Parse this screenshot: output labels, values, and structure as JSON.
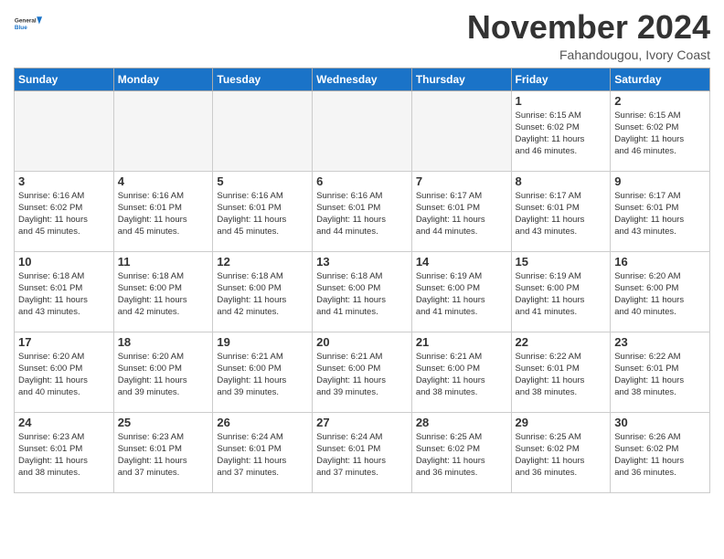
{
  "header": {
    "logo_line1": "General",
    "logo_line2": "Blue",
    "month_title": "November 2024",
    "location": "Fahandougou, Ivory Coast"
  },
  "weekdays": [
    "Sunday",
    "Monday",
    "Tuesday",
    "Wednesday",
    "Thursday",
    "Friday",
    "Saturday"
  ],
  "weeks": [
    [
      {
        "day": "",
        "info": ""
      },
      {
        "day": "",
        "info": ""
      },
      {
        "day": "",
        "info": ""
      },
      {
        "day": "",
        "info": ""
      },
      {
        "day": "",
        "info": ""
      },
      {
        "day": "1",
        "info": "Sunrise: 6:15 AM\nSunset: 6:02 PM\nDaylight: 11 hours\nand 46 minutes."
      },
      {
        "day": "2",
        "info": "Sunrise: 6:15 AM\nSunset: 6:02 PM\nDaylight: 11 hours\nand 46 minutes."
      }
    ],
    [
      {
        "day": "3",
        "info": "Sunrise: 6:16 AM\nSunset: 6:02 PM\nDaylight: 11 hours\nand 45 minutes."
      },
      {
        "day": "4",
        "info": "Sunrise: 6:16 AM\nSunset: 6:01 PM\nDaylight: 11 hours\nand 45 minutes."
      },
      {
        "day": "5",
        "info": "Sunrise: 6:16 AM\nSunset: 6:01 PM\nDaylight: 11 hours\nand 45 minutes."
      },
      {
        "day": "6",
        "info": "Sunrise: 6:16 AM\nSunset: 6:01 PM\nDaylight: 11 hours\nand 44 minutes."
      },
      {
        "day": "7",
        "info": "Sunrise: 6:17 AM\nSunset: 6:01 PM\nDaylight: 11 hours\nand 44 minutes."
      },
      {
        "day": "8",
        "info": "Sunrise: 6:17 AM\nSunset: 6:01 PM\nDaylight: 11 hours\nand 43 minutes."
      },
      {
        "day": "9",
        "info": "Sunrise: 6:17 AM\nSunset: 6:01 PM\nDaylight: 11 hours\nand 43 minutes."
      }
    ],
    [
      {
        "day": "10",
        "info": "Sunrise: 6:18 AM\nSunset: 6:01 PM\nDaylight: 11 hours\nand 43 minutes."
      },
      {
        "day": "11",
        "info": "Sunrise: 6:18 AM\nSunset: 6:00 PM\nDaylight: 11 hours\nand 42 minutes."
      },
      {
        "day": "12",
        "info": "Sunrise: 6:18 AM\nSunset: 6:00 PM\nDaylight: 11 hours\nand 42 minutes."
      },
      {
        "day": "13",
        "info": "Sunrise: 6:18 AM\nSunset: 6:00 PM\nDaylight: 11 hours\nand 41 minutes."
      },
      {
        "day": "14",
        "info": "Sunrise: 6:19 AM\nSunset: 6:00 PM\nDaylight: 11 hours\nand 41 minutes."
      },
      {
        "day": "15",
        "info": "Sunrise: 6:19 AM\nSunset: 6:00 PM\nDaylight: 11 hours\nand 41 minutes."
      },
      {
        "day": "16",
        "info": "Sunrise: 6:20 AM\nSunset: 6:00 PM\nDaylight: 11 hours\nand 40 minutes."
      }
    ],
    [
      {
        "day": "17",
        "info": "Sunrise: 6:20 AM\nSunset: 6:00 PM\nDaylight: 11 hours\nand 40 minutes."
      },
      {
        "day": "18",
        "info": "Sunrise: 6:20 AM\nSunset: 6:00 PM\nDaylight: 11 hours\nand 39 minutes."
      },
      {
        "day": "19",
        "info": "Sunrise: 6:21 AM\nSunset: 6:00 PM\nDaylight: 11 hours\nand 39 minutes."
      },
      {
        "day": "20",
        "info": "Sunrise: 6:21 AM\nSunset: 6:00 PM\nDaylight: 11 hours\nand 39 minutes."
      },
      {
        "day": "21",
        "info": "Sunrise: 6:21 AM\nSunset: 6:00 PM\nDaylight: 11 hours\nand 38 minutes."
      },
      {
        "day": "22",
        "info": "Sunrise: 6:22 AM\nSunset: 6:01 PM\nDaylight: 11 hours\nand 38 minutes."
      },
      {
        "day": "23",
        "info": "Sunrise: 6:22 AM\nSunset: 6:01 PM\nDaylight: 11 hours\nand 38 minutes."
      }
    ],
    [
      {
        "day": "24",
        "info": "Sunrise: 6:23 AM\nSunset: 6:01 PM\nDaylight: 11 hours\nand 38 minutes."
      },
      {
        "day": "25",
        "info": "Sunrise: 6:23 AM\nSunset: 6:01 PM\nDaylight: 11 hours\nand 37 minutes."
      },
      {
        "day": "26",
        "info": "Sunrise: 6:24 AM\nSunset: 6:01 PM\nDaylight: 11 hours\nand 37 minutes."
      },
      {
        "day": "27",
        "info": "Sunrise: 6:24 AM\nSunset: 6:01 PM\nDaylight: 11 hours\nand 37 minutes."
      },
      {
        "day": "28",
        "info": "Sunrise: 6:25 AM\nSunset: 6:02 PM\nDaylight: 11 hours\nand 36 minutes."
      },
      {
        "day": "29",
        "info": "Sunrise: 6:25 AM\nSunset: 6:02 PM\nDaylight: 11 hours\nand 36 minutes."
      },
      {
        "day": "30",
        "info": "Sunrise: 6:26 AM\nSunset: 6:02 PM\nDaylight: 11 hours\nand 36 minutes."
      }
    ]
  ]
}
